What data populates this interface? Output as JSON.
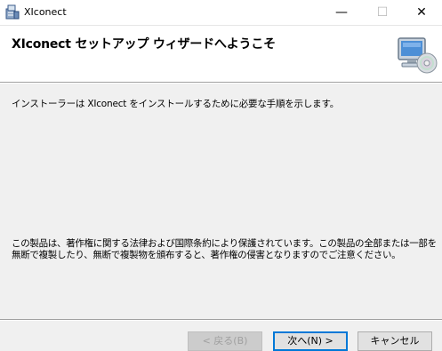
{
  "window": {
    "title": "XIconect",
    "minimize_glyph": "—",
    "maximize_glyph": "☐",
    "close_glyph": "✕"
  },
  "banner": {
    "title": "XIconect セットアップ ウィザードへようこそ",
    "art_icon": "computer-cd-icon"
  },
  "content": {
    "intro": "インストーラーは XIconect をインストールするために必要な手順を示します。",
    "copyright": "この製品は、著作権に関する法律および国際条約により保護されています。この製品の全部または一部を無断で複製したり、無断で複製物を頒布すると、著作権の侵害となりますのでご注意ください。"
  },
  "buttons": {
    "back": "< 戻る(B)",
    "next": "次へ(N) >",
    "cancel": "キャンセル"
  },
  "colors": {
    "accent": "#0078d7",
    "background": "#f0f0f0"
  }
}
